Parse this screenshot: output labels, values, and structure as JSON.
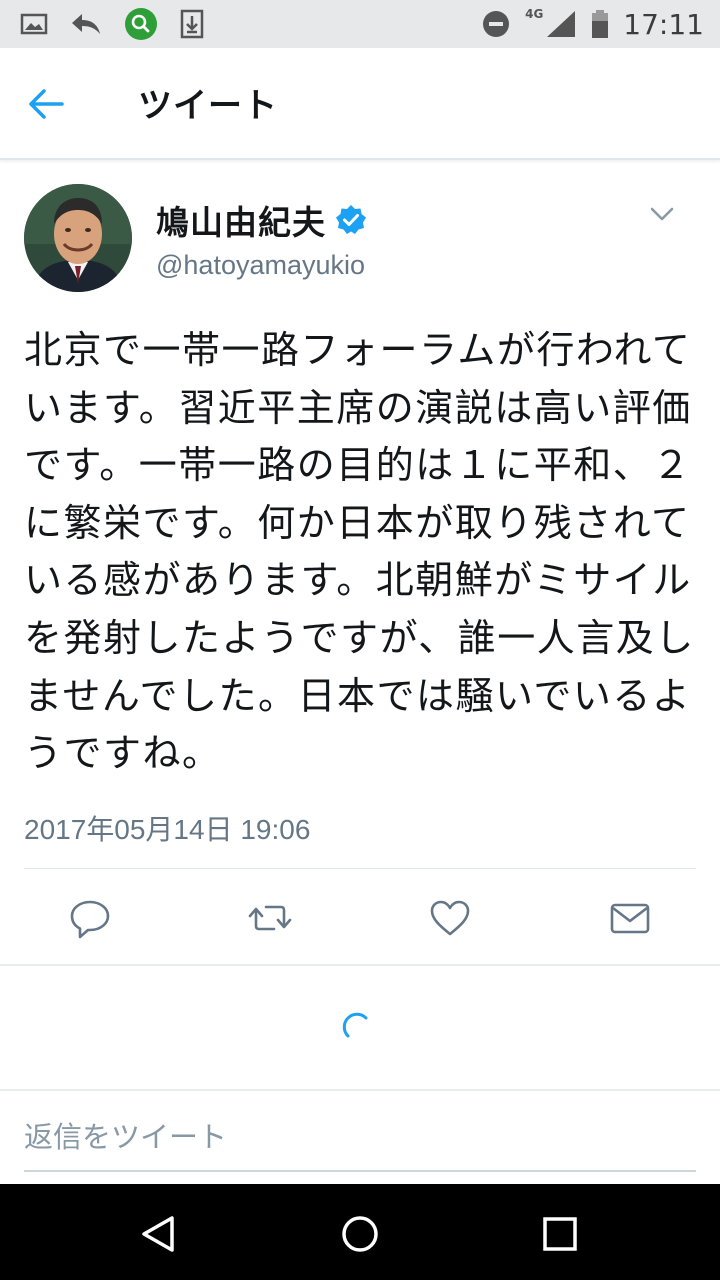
{
  "status_bar": {
    "network": "4G",
    "time": "17:11",
    "icons": [
      "image-icon",
      "reply-arrow-icon",
      "search-app-icon",
      "download-icon",
      "do-not-disturb-icon",
      "signal-icon",
      "battery-icon"
    ]
  },
  "app_bar": {
    "title": "ツイート",
    "back_icon": "back-arrow-icon"
  },
  "tweet": {
    "author_name": "鳩山由紀夫",
    "verified": true,
    "handle": "@hatoyamayukio",
    "text": "北京で一帯一路フォーラムが行われています。習近平主席の演説は高い評価です。一帯一路の目的は１に平和、２に繁栄です。何か日本が取り残されている感があります。北朝鮮がミサイルを発射したようですが、誰一人言及しませんでした。日本では騒いでいるようですね。",
    "timestamp": "2017年05月14日 19:06"
  },
  "actions": [
    "reply-icon",
    "retweet-icon",
    "like-icon",
    "direct-message-icon"
  ],
  "reply": {
    "placeholder": "返信をツイート"
  },
  "colors": {
    "accent": "#1da1f2",
    "muted": "#657786",
    "text": "#14171a"
  }
}
